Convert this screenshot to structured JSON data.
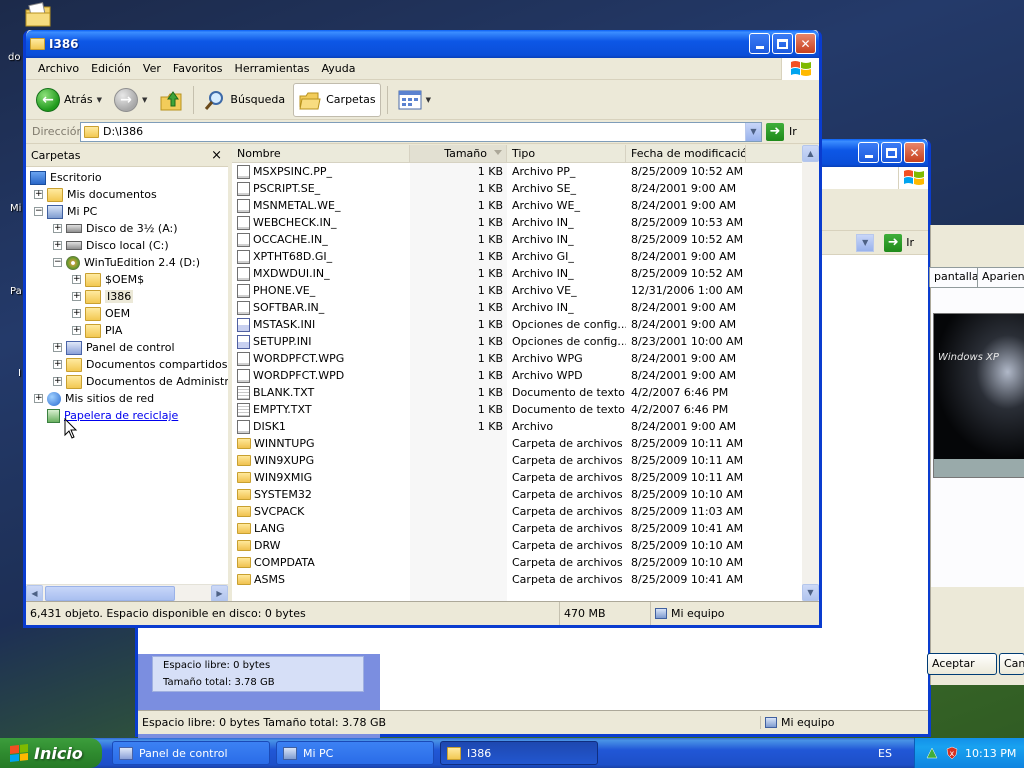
{
  "desktop": {
    "fragments": [
      "do",
      "Mi",
      "Pa",
      "I"
    ]
  },
  "bg_window": {
    "address_go": "Ir",
    "tabs": [
      "pantalla",
      "Aparienci"
    ],
    "preview_text": "Windows XP",
    "panel_free": "Espacio libre: 0 bytes",
    "panel_total": "Tamaño total: 3.78 GB",
    "status_text": "Espacio libre: 0 bytes Tamaño total: 3.78 GB",
    "status_location": "Mi equipo",
    "dialog_buttons": [
      "Aceptar",
      "Can"
    ]
  },
  "window": {
    "title": "I386",
    "menu": [
      "Archivo",
      "Edición",
      "Ver",
      "Favoritos",
      "Herramientas",
      "Ayuda"
    ],
    "toolbar": {
      "back": "Atrás",
      "search": "Búsqueda",
      "folders": "Carpetas"
    },
    "address": {
      "label": "Dirección",
      "value": "D:\\I386",
      "go": "Ir"
    }
  },
  "tree": {
    "title": "Carpetas",
    "close": "×",
    "items": [
      {
        "label": "Escritorio",
        "icon": "desktop-icon"
      },
      {
        "label": "Mis documentos",
        "icon": "folder-icon"
      },
      {
        "label": "Mi PC",
        "icon": "computer-icon"
      },
      {
        "label": "Disco de 3½ (A:)",
        "icon": "floppy-drive-icon"
      },
      {
        "label": "Disco local (C:)",
        "icon": "hard-drive-icon"
      },
      {
        "label": "WinTuEdition 2.4 (D:)",
        "icon": "cd-drive-icon"
      },
      {
        "label": "$OEM$",
        "icon": "folder-icon"
      },
      {
        "label": "I386",
        "icon": "folder-icon"
      },
      {
        "label": "OEM",
        "icon": "folder-icon"
      },
      {
        "label": "PIA",
        "icon": "folder-icon"
      },
      {
        "label": "Panel de control",
        "icon": "control-panel-icon"
      },
      {
        "label": "Documentos compartidos",
        "icon": "folder-icon"
      },
      {
        "label": "Documentos de Administrador",
        "icon": "folder-icon"
      },
      {
        "label": "Mis sitios de red",
        "icon": "network-icon"
      },
      {
        "label": "Papelera de reciclaje",
        "icon": "recycle-bin-icon"
      }
    ]
  },
  "columns": {
    "name": "Nombre",
    "size": "Tamaño",
    "type": "Tipo",
    "date": "Fecha de modificación"
  },
  "files": [
    {
      "name": "MSXPSINC.PP_",
      "size": "1 KB",
      "type": "Archivo PP_",
      "date": "8/25/2009 10:52 AM",
      "icon": "file"
    },
    {
      "name": "PSCRIPT.SE_",
      "size": "1 KB",
      "type": "Archivo SE_",
      "date": "8/24/2001 9:00 AM",
      "icon": "file"
    },
    {
      "name": "MSNMETAL.WE_",
      "size": "1 KB",
      "type": "Archivo WE_",
      "date": "8/24/2001 9:00 AM",
      "icon": "file"
    },
    {
      "name": "WEBCHECK.IN_",
      "size": "1 KB",
      "type": "Archivo IN_",
      "date": "8/25/2009 10:53 AM",
      "icon": "file"
    },
    {
      "name": "OCCACHE.IN_",
      "size": "1 KB",
      "type": "Archivo IN_",
      "date": "8/25/2009 10:52 AM",
      "icon": "file"
    },
    {
      "name": "XPTHT68D.GI_",
      "size": "1 KB",
      "type": "Archivo GI_",
      "date": "8/24/2001 9:00 AM",
      "icon": "file"
    },
    {
      "name": "MXDWDUI.IN_",
      "size": "1 KB",
      "type": "Archivo IN_",
      "date": "8/25/2009 10:52 AM",
      "icon": "file"
    },
    {
      "name": "PHONE.VE_",
      "size": "1 KB",
      "type": "Archivo VE_",
      "date": "12/31/2006 1:00 AM",
      "icon": "file"
    },
    {
      "name": "SOFTBAR.IN_",
      "size": "1 KB",
      "type": "Archivo IN_",
      "date": "8/24/2001 9:00 AM",
      "icon": "file"
    },
    {
      "name": "MSTASK.INI",
      "size": "1 KB",
      "type": "Opciones de config...",
      "date": "8/24/2001 9:00 AM",
      "icon": "ini"
    },
    {
      "name": "SETUPP.INI",
      "size": "1 KB",
      "type": "Opciones de config...",
      "date": "8/23/2001 10:00 AM",
      "icon": "ini"
    },
    {
      "name": "WORDPFCT.WPG",
      "size": "1 KB",
      "type": "Archivo WPG",
      "date": "8/24/2001 9:00 AM",
      "icon": "file"
    },
    {
      "name": "WORDPFCT.WPD",
      "size": "1 KB",
      "type": "Archivo WPD",
      "date": "8/24/2001 9:00 AM",
      "icon": "file"
    },
    {
      "name": "BLANK.TXT",
      "size": "1 KB",
      "type": "Documento de texto",
      "date": "4/2/2007 6:46 PM",
      "icon": "txt"
    },
    {
      "name": "EMPTY.TXT",
      "size": "1 KB",
      "type": "Documento de texto",
      "date": "4/2/2007 6:46 PM",
      "icon": "txt"
    },
    {
      "name": "DISK1",
      "size": "1 KB",
      "type": "Archivo",
      "date": "8/24/2001 9:00 AM",
      "icon": "file"
    },
    {
      "name": "WINNTUPG",
      "size": "",
      "type": "Carpeta de archivos",
      "date": "8/25/2009 10:11 AM",
      "icon": "folder"
    },
    {
      "name": "WIN9XUPG",
      "size": "",
      "type": "Carpeta de archivos",
      "date": "8/25/2009 10:11 AM",
      "icon": "folder"
    },
    {
      "name": "WIN9XMIG",
      "size": "",
      "type": "Carpeta de archivos",
      "date": "8/25/2009 10:11 AM",
      "icon": "folder"
    },
    {
      "name": "SYSTEM32",
      "size": "",
      "type": "Carpeta de archivos",
      "date": "8/25/2009 10:10 AM",
      "icon": "folder"
    },
    {
      "name": "SVCPACK",
      "size": "",
      "type": "Carpeta de archivos",
      "date": "8/25/2009 11:03 AM",
      "icon": "folder"
    },
    {
      "name": "LANG",
      "size": "",
      "type": "Carpeta de archivos",
      "date": "8/25/2009 10:41 AM",
      "icon": "folder"
    },
    {
      "name": "DRW",
      "size": "",
      "type": "Carpeta de archivos",
      "date": "8/25/2009 10:10 AM",
      "icon": "folder"
    },
    {
      "name": "COMPDATA",
      "size": "",
      "type": "Carpeta de archivos",
      "date": "8/25/2009 10:10 AM",
      "icon": "folder"
    },
    {
      "name": "ASMS",
      "size": "",
      "type": "Carpeta de archivos",
      "date": "8/25/2009 10:41 AM",
      "icon": "folder"
    }
  ],
  "status": {
    "objects": "6,431 objeto. Espacio disponible en disco:  0 bytes",
    "size": "470 MB",
    "location": "Mi equipo"
  },
  "taskbar": {
    "start": "Inicio",
    "tasks": [
      {
        "label": "Panel de control",
        "active": false
      },
      {
        "label": "Mi PC",
        "active": false
      },
      {
        "label": "I386",
        "active": true
      }
    ],
    "language": "ES",
    "clock": "10:13 PM"
  },
  "colors": {
    "titlebar": "#0a4ed8",
    "start_button": "#2f8b2f",
    "taskbar": "#2157d7",
    "tray": "#19a2f0"
  }
}
